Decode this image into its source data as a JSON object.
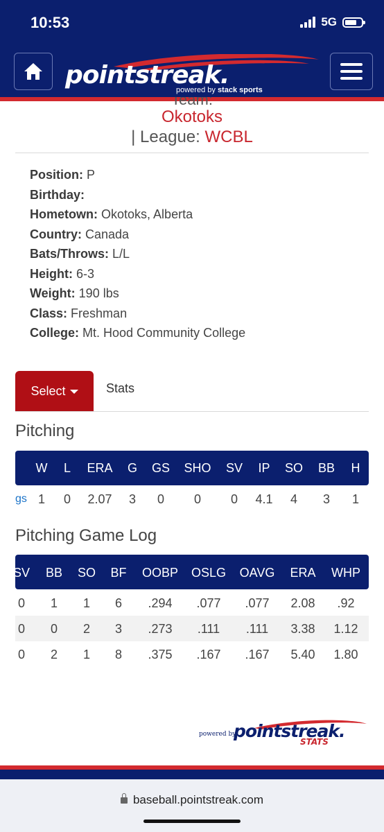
{
  "status": {
    "time": "10:53",
    "network": "5G"
  },
  "header": {
    "logo_text": "pointstreak.",
    "powered_prefix": "powered by",
    "powered_brand": "stack sports"
  },
  "team": {
    "label": "Team:",
    "name": "Okotoks",
    "league_label": "| League:",
    "league_value": "WCBL"
  },
  "bio": [
    {
      "label": "Position:",
      "value": "P"
    },
    {
      "label": "Birthday:",
      "value": ""
    },
    {
      "label": "Hometown:",
      "value": "Okotoks, Alberta"
    },
    {
      "label": "Country:",
      "value": "Canada"
    },
    {
      "label": "Bats/Throws:",
      "value": "L/L"
    },
    {
      "label": "Height:",
      "value": "6-3"
    },
    {
      "label": "Weight:",
      "value": "190 lbs"
    },
    {
      "label": "Class:",
      "value": "Freshman"
    },
    {
      "label": "College:",
      "value": "Mt. Hood Community College"
    }
  ],
  "tabs": {
    "select_label": "Select",
    "stats_label": "Stats"
  },
  "pitching": {
    "title": "Pitching",
    "row_link_fragment": "gs",
    "headers": [
      "W",
      "L",
      "ERA",
      "G",
      "GS",
      "SHO",
      "SV",
      "IP",
      "SO",
      "BB",
      "H"
    ],
    "row": [
      "1",
      "0",
      "2.07",
      "3",
      "0",
      "0",
      "0",
      "4.1",
      "4",
      "3",
      "1"
    ]
  },
  "game_log": {
    "title": "Pitching Game Log",
    "headers": [
      "SV",
      "BB",
      "SO",
      "BF",
      "OOBP",
      "OSLG",
      "OAVG",
      "ERA",
      "WHP"
    ],
    "rows": [
      [
        "0",
        "1",
        "1",
        "6",
        ".294",
        ".077",
        ".077",
        "2.08",
        ".92"
      ],
      [
        "0",
        "0",
        "2",
        "3",
        ".273",
        ".111",
        ".111",
        "3.38",
        "1.12"
      ],
      [
        "0",
        "2",
        "1",
        "8",
        ".375",
        ".167",
        ".167",
        "5.40",
        "1.80"
      ]
    ]
  },
  "footer": {
    "powered": "powered by",
    "logo_text": "pointstreak.",
    "stats": "STATS"
  },
  "browser": {
    "url": "baseball.pointstreak.com"
  },
  "colors": {
    "navy": "#0b1f6e",
    "red": "#d32a2f",
    "team_red": "#c8262e",
    "select_red": "#b00f15"
  }
}
